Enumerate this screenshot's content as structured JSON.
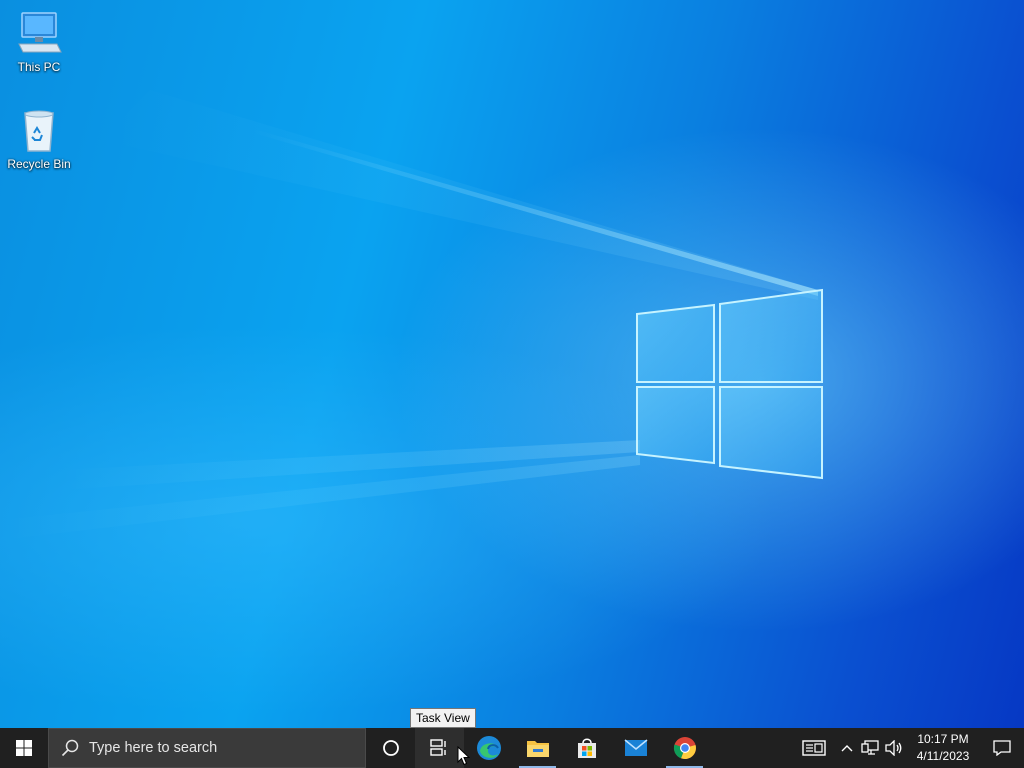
{
  "desktop": {
    "icons": [
      {
        "label": "This PC",
        "icon": "this-pc-icon"
      },
      {
        "label": "Recycle Bin",
        "icon": "recycle-bin-icon"
      }
    ]
  },
  "taskbar": {
    "search_placeholder": "Type here to search",
    "tooltip": "Task View",
    "apps": [
      {
        "name": "Cortana",
        "icon": "cortana-icon"
      },
      {
        "name": "Task View",
        "icon": "task-view-icon"
      },
      {
        "name": "Microsoft Edge",
        "icon": "edge-icon"
      },
      {
        "name": "File Explorer",
        "icon": "file-explorer-icon"
      },
      {
        "name": "Microsoft Store",
        "icon": "store-icon"
      },
      {
        "name": "Mail",
        "icon": "mail-icon"
      },
      {
        "name": "Google Chrome",
        "icon": "chrome-icon"
      }
    ],
    "clock": {
      "time": "10:17 PM",
      "date": "4/11/2023"
    }
  },
  "colors": {
    "accent": "#0a7fe0",
    "taskbar": "#202020"
  }
}
